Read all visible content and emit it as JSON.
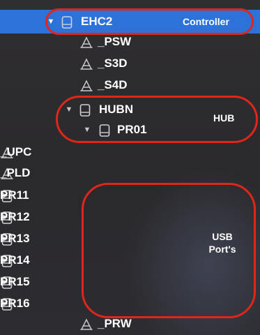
{
  "tree": {
    "rows": [
      {
        "label": "EHC2",
        "icon": "device-icon",
        "expander": "expanded",
        "selected": true
      },
      {
        "label": "_PSW",
        "icon": "method-icon"
      },
      {
        "label": "_S3D",
        "icon": "method-icon"
      },
      {
        "label": "_S4D",
        "icon": "method-icon"
      },
      {
        "label": "HUBN",
        "icon": "device-icon",
        "expander": "expanded"
      },
      {
        "label": "PR01",
        "icon": "device-icon",
        "expander": "expanded"
      },
      {
        "label": "_UPC",
        "icon": "method-icon"
      },
      {
        "label": "_PLD",
        "icon": "method-icon"
      },
      {
        "label": "PR11",
        "icon": "device-icon",
        "expander": "collapsed"
      },
      {
        "label": "PR12",
        "icon": "device-icon",
        "expander": "collapsed"
      },
      {
        "label": "PR13",
        "icon": "device-icon",
        "expander": "collapsed"
      },
      {
        "label": "PR14",
        "icon": "device-icon",
        "expander": "collapsed"
      },
      {
        "label": "PR15",
        "icon": "device-icon",
        "expander": "collapsed"
      },
      {
        "label": "PR16",
        "icon": "device-icon",
        "expander": "collapsed"
      },
      {
        "label": "_PRW",
        "icon": "method-icon"
      }
    ]
  },
  "annotations": {
    "controller": "Controller",
    "hub": "HUB",
    "usb_line1": "USB",
    "usb_line2": "Port's",
    "outline_color": "#e0251b"
  },
  "colors": {
    "selection": "#2d72d9",
    "background": "#2b2a2d"
  }
}
